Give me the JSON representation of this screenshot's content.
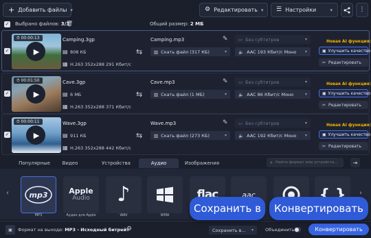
{
  "toolbar": {
    "add_files": "Добавить файлы",
    "edit": "Редактировать",
    "settings": "Настройки"
  },
  "summary": {
    "selected_label": "Выбрано файлов:",
    "selected_count": "3/3",
    "total_size_label": "Общий размер:",
    "total_size": "2 МБ"
  },
  "files": [
    {
      "duration": "00:00:13",
      "name": "Camping.3gp",
      "size": "808 КБ",
      "codec": "H.263 352x288 291 Кбит/с",
      "output_name": "Camping.mp3",
      "output_size": "Скать файл (317 КБ)",
      "subtitles": "Без субтитров",
      "audio": "AAC 193 Кбит/с Моно",
      "ai_label": "Новая AI функция:",
      "quality_button": "Улучшить качество",
      "edit_button": "Редактировать"
    },
    {
      "duration": "00:01:50",
      "name": "Cave.3gp",
      "size": "6 МБ",
      "codec": "H.263 352x288 371 Кбит/с",
      "output_name": "Cave.mp3",
      "output_size": "Скать файл (1 МБ)",
      "subtitles": "Без субтитров",
      "audio": "AAC 86 Кбит/с Моно",
      "ai_label": "Новая AI функция:",
      "quality_button": "Улучшить качество",
      "edit_button": "Редактировать"
    },
    {
      "duration": "00:00:11",
      "name": "Wave.3gp",
      "size": "911 КБ",
      "codec": "H.263 352x288 442 Кбит/с",
      "output_name": "Wave.mp3",
      "output_size": "Скать файл (273 КБ)",
      "subtitles": "Без субтитров",
      "audio": "AAC 192 Кбит/с Моно",
      "ai_label": "Новая AI функция:",
      "quality_button": "Улучшить качество",
      "edit_button": "Редактировать"
    }
  ],
  "tabs": [
    "Популярные",
    "Видео",
    "Устройства",
    "Аудио",
    "Изображения"
  ],
  "active_tab": "Аудио",
  "search_placeholder": "Найти формат или устройств...",
  "formats": [
    {
      "icon": "mp3",
      "label": "MP3"
    },
    {
      "icon": "Apple Audio",
      "label": "Аудио для Apple"
    },
    {
      "icon": "wav-icon",
      "label": "WAV"
    },
    {
      "icon": "wma-icon",
      "label": "WMA"
    },
    {
      "icon": "flac",
      "label": ""
    },
    {
      "icon": "aac",
      "label": ""
    },
    {
      "icon": "ogg-icon",
      "label": ""
    },
    {
      "icon": "braces-icon",
      "label": ""
    }
  ],
  "bottom": {
    "output_format_label": "Формат на выходе:",
    "output_format_value": "MP3 - Исходный битрейт",
    "save_to": "Сохранить в...",
    "merge_label": "Объединить:",
    "convert": "Конвертировать"
  },
  "overlay": {
    "save_to": "Сохранить в",
    "convert": "Конвертировать"
  },
  "colors": {
    "background": "#1b1f2c",
    "accent": "#2f5ad8",
    "ai_label": "#f0b500"
  }
}
